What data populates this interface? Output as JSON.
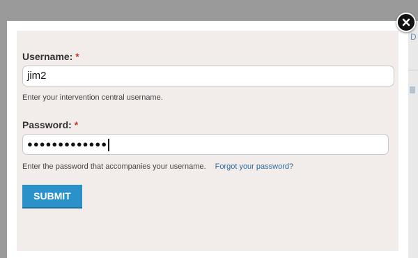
{
  "dialog": {
    "username": {
      "label": "Username:",
      "required_mark": "*",
      "value": "jim2",
      "help": "Enter your intervention central username."
    },
    "password": {
      "label": "Password:",
      "required_mark": "*",
      "masked_value": "●●●●●●●●●●●●●",
      "help": "Enter the password that accompanies your username.",
      "forgot_link": "Forgot your password?"
    },
    "submit_label": "SUBMIT",
    "close_icon": "close-icon"
  },
  "background_page": {
    "peek_letter": "D"
  },
  "colors": {
    "accent": "#2a91c9",
    "link": "#2a6aa0",
    "required": "#c0392b",
    "panel": "#f2edeb"
  }
}
